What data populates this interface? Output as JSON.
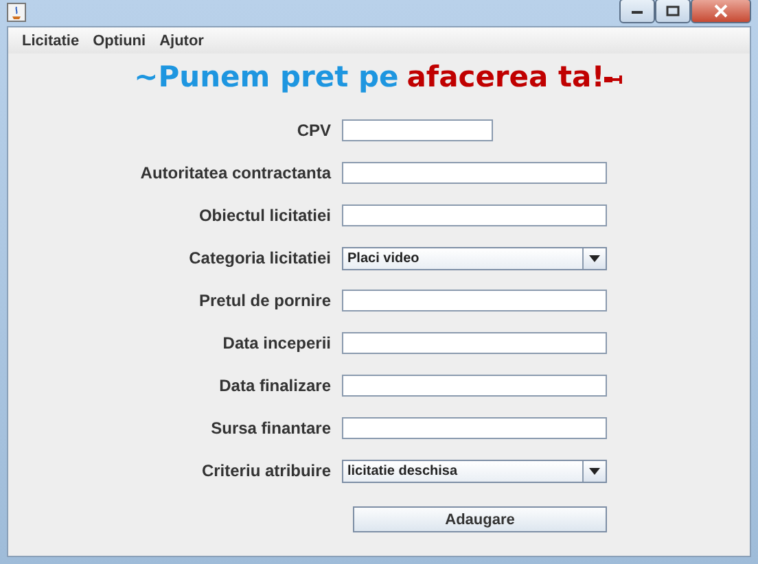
{
  "menu": [
    "Licitatie",
    "Optiuni",
    "Ajutor"
  ],
  "banner": {
    "part_1": "~Punem pret pe",
    "part_2": "afacerea ta!"
  },
  "fields": [
    {
      "label": "CPV",
      "kind": "short"
    },
    {
      "label": "Autoritatea contractanta",
      "kind": "text"
    },
    {
      "label": "Obiectul licitatiei",
      "kind": "text"
    },
    {
      "label": "Categoria licitatiei",
      "kind": "combo",
      "value": "Placi video"
    },
    {
      "label": "Pretul de pornire",
      "kind": "text"
    },
    {
      "label": "Data inceperii",
      "kind": "text"
    },
    {
      "label": "Data finalizare",
      "kind": "text"
    },
    {
      "label": "Sursa finantare",
      "kind": "text"
    },
    {
      "label": "Criteriu atribuire",
      "kind": "combo",
      "value": "licitatie deschisa"
    }
  ],
  "buttons": [
    "Adaugare"
  ]
}
